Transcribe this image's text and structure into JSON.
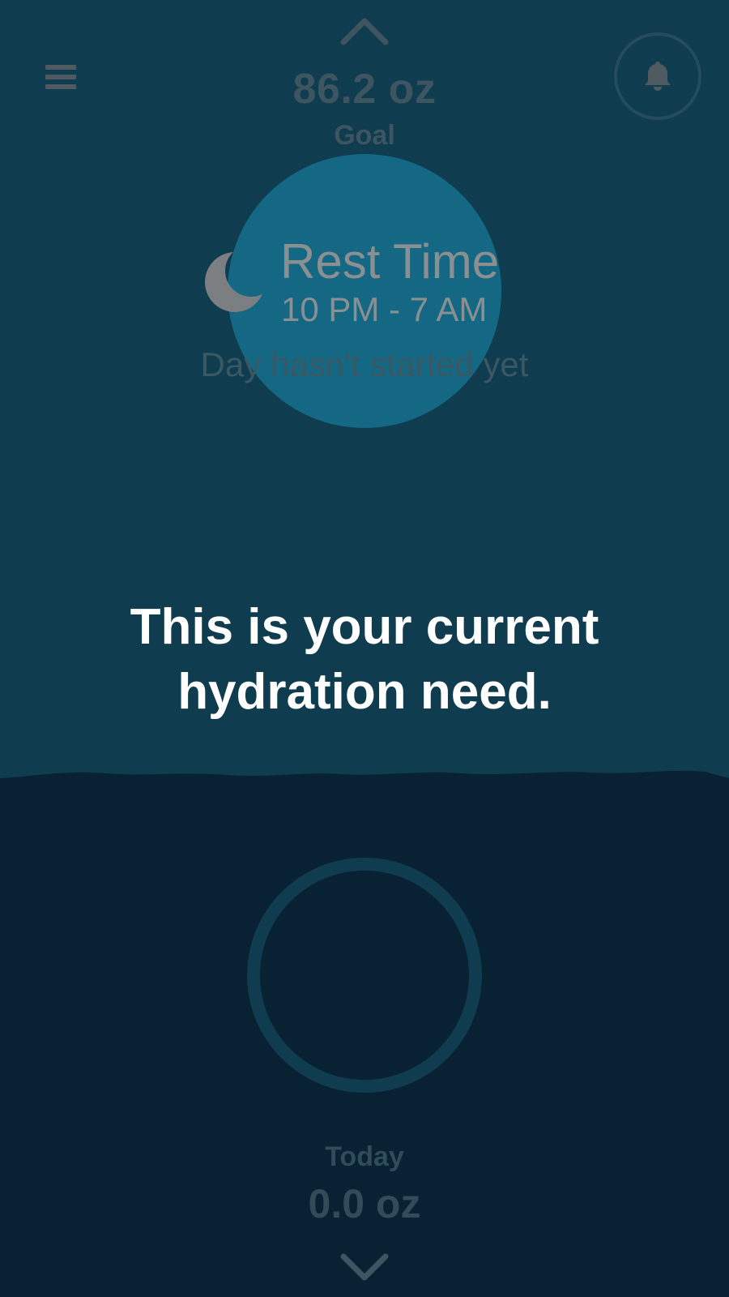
{
  "header": {
    "goal_value": "86.2 oz",
    "goal_label": "Goal"
  },
  "icons": {
    "menu": "hamburger-menu-icon",
    "notifications": "bell-icon",
    "rest": "moon-icon",
    "scroll_up": "chevron-up-icon",
    "scroll_down": "chevron-down-icon"
  },
  "rest_time": {
    "title": "Rest Time",
    "hours": "10 PM - 7 AM",
    "status": "Day hasn't started yet"
  },
  "coach_mark": {
    "message_line1": "This is your current",
    "message_line2": "hydration need."
  },
  "today": {
    "label": "Today",
    "value": "0.0 oz",
    "progress_fraction": 0
  },
  "colors": {
    "top_background": "#0f3c4e",
    "bottom_background": "#082133",
    "highlight": "#146884",
    "ring": "#0f3c4e"
  }
}
